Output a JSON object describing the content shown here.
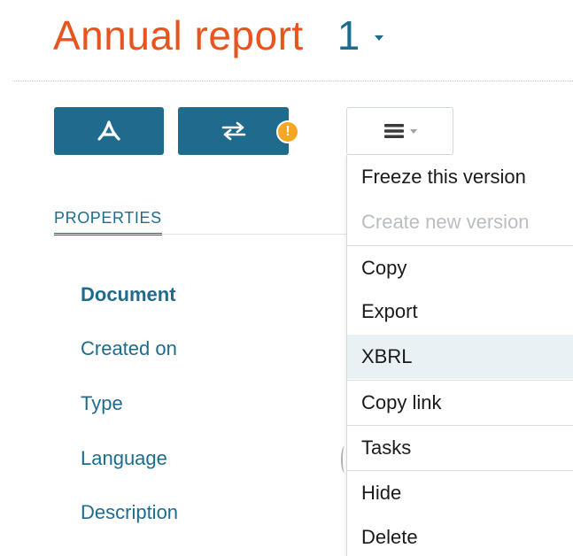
{
  "header": {
    "title": "Annual report",
    "version": "1"
  },
  "toolbar": {
    "pdf_icon": "pdf-icon",
    "sync_icon": "swap-arrows-icon",
    "warning_badge": "!",
    "menu_icon": "hamburger-icon"
  },
  "properties": {
    "tab_label": "PROPERTIES",
    "labels": [
      "Document",
      "Created on",
      "Type",
      "Language",
      "Description"
    ]
  },
  "menu": {
    "items": [
      {
        "label": "Freeze this version"
      },
      {
        "label": "Create new version"
      },
      {
        "label": "Copy"
      },
      {
        "label": "Export"
      },
      {
        "label": "XBRL"
      },
      {
        "label": "Copy link"
      },
      {
        "label": "Tasks"
      },
      {
        "label": "Hide"
      },
      {
        "label": "Delete"
      }
    ]
  },
  "colors": {
    "title": "#e8541e",
    "brand": "#1f6b8e",
    "warning": "#f5a623",
    "disabled": "#b9bec2",
    "highlight": "#e8f1f3"
  }
}
